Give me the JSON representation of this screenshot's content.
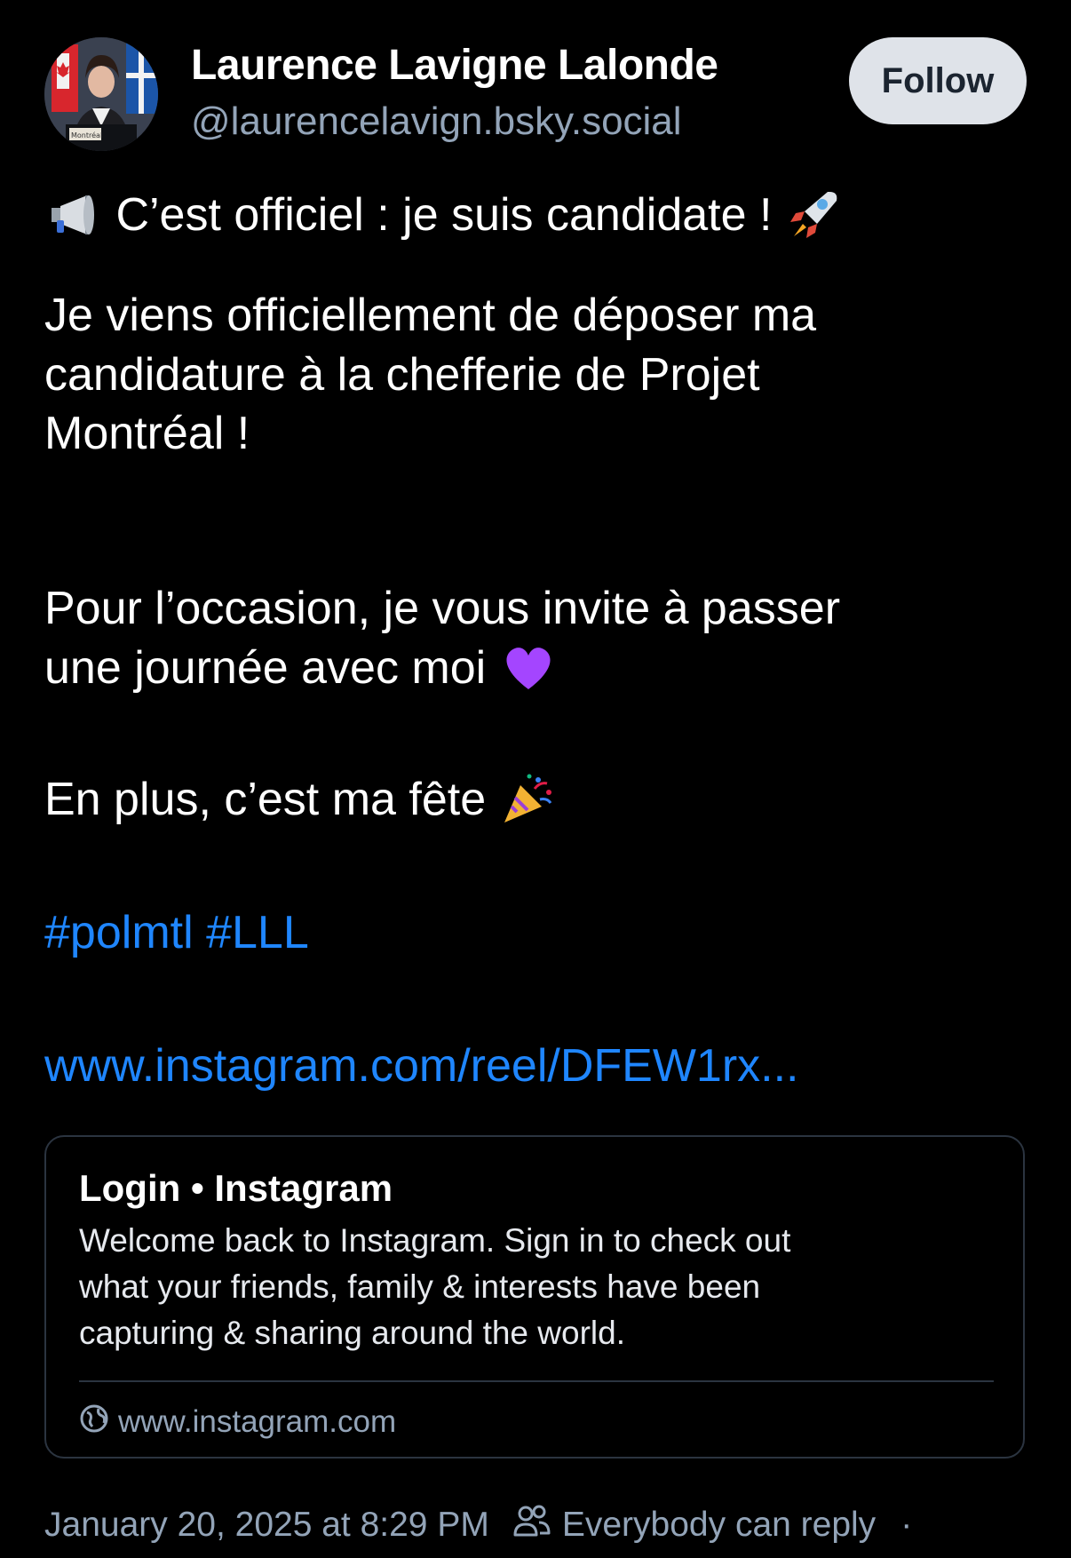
{
  "author": {
    "name": "Laurence Lavigne Lalonde",
    "handle": "@laurencelavign.bsky.social",
    "avatar_icon": "profile-photo",
    "avatar_sign_text": "Montréal"
  },
  "actions": {
    "follow_label": "Follow"
  },
  "post": {
    "line1": "C’est officiel : je suis candidate !",
    "line1_emoji_left": "megaphone-icon",
    "line1_emoji_right": "rocket-icon",
    "line2": "Je viens officiellement de déposer ma",
    "line3": "candidature à la chefferie de Projet",
    "line4": "Montréal !",
    "line5": "Pour l’occasion, je vous invite à passer",
    "line6": "une journée avec moi",
    "line6_emoji": "purple-heart-icon",
    "line7": "En plus, c’est ma fête",
    "line7_emoji": "party-popper-icon",
    "hashtags": "#polmtl #LLL",
    "link": "www.instagram.com/reel/DFEW1rx..."
  },
  "link_card": {
    "title": "Login • Instagram",
    "desc_line1": "Welcome back to Instagram. Sign in to check out",
    "desc_line2": "what your friends, family & interests have been",
    "desc_line3": "capturing & sharing around the world.",
    "domain": "www.instagram.com",
    "domain_icon": "globe-icon"
  },
  "meta": {
    "timestamp": "January 20, 2025 at 8:29 PM",
    "reply_setting": "Everybody can reply",
    "reply_icon": "people-icon",
    "separator": "·"
  },
  "colors": {
    "background": "#000000",
    "text": "#ffffff",
    "muted": "#93a4b8",
    "link": "#1f86ff",
    "follow_bg": "#dfe3e9",
    "card_border": "#2b3440"
  }
}
